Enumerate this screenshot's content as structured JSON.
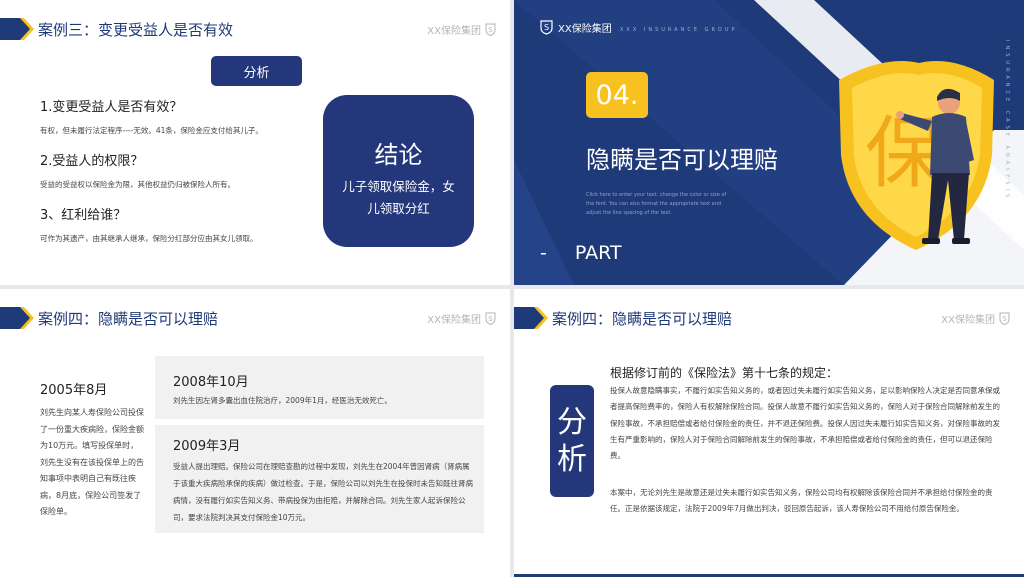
{
  "brand": {
    "name": "XX保险集团",
    "tagline": "XXX INSURANCE GROUP",
    "side_text": "INSURANCE CASE ANALYSIS",
    "navy": "#1f3a78",
    "yellow": "#f7c21f"
  },
  "slide1": {
    "title": "案例三：变更受益人是否有效",
    "analysis_button": "分析",
    "items": [
      {
        "question": "1.变更受益人是否有效？",
        "answer": "有权，但未履行法定程序----无效。41条，保险金应支付给其儿子。"
      },
      {
        "question": "2.受益人的权限？",
        "answer": "受益的受益权以保险金为限，其他权益仍归被保险人所有。"
      },
      {
        "question": "3、红利给谁？",
        "answer": "可作为其遗产，由其继承人继承，保险分红部分应由其女儿领取。"
      }
    ],
    "conclusion": {
      "title": "结论",
      "body": "儿子领取保险金，女儿领取分红"
    }
  },
  "slide2": {
    "number": "04.",
    "title": "隐瞒是否可以理赔",
    "placeholder_text": "Click here to enter your text. change the color or size of the font. You can also format the appropriate text and adjust the line spacing of the text.",
    "part_label": "PART",
    "dash": "-",
    "shield_char": "保"
  },
  "slide3": {
    "title": "案例四：隐瞒是否可以理赔",
    "year_2005": "2005年8月",
    "text_2005": "刘先生向某人寿保险公司投保了一份重大疾病险，保险金额为10万元。填写投保单时，刘先生没有在该投保单上的告知事项中表明自己有既往疾病，8月底，保险公司签发了保险单。",
    "events": [
      {
        "date": "2008年10月",
        "text": "刘先生因左肾多囊出血住院治疗，2009年1月，经医治无效死亡。"
      },
      {
        "date": "2009年3月",
        "text": "受益人提出理赔。保险公司在理赔查勘的过程中发现，刘先生在2004年曾因肾病（肾病属于该重大疾病险承保的疾病）做过检查。于是，保险公司以刘先生在投保时未告知既往肾病病情，没有履行如实告知义务、带病投保为由拒赔，并解除合同。刘先生家人起诉保险公司，要求法院判决其支付保险金10万元。"
      }
    ]
  },
  "slide4": {
    "title": "案例四：隐瞒是否可以理赔",
    "box_char1": "分",
    "box_char2": "析",
    "heading": "根据修订前的《保险法》第十七条的规定：",
    "para1": "投保人故意隐瞒事实，不履行如实告知义务的，或者因过失未履行如实告知义务，足以影响保险人决定是否同意承保或者提高保险费率的，保险人有权解除保险合同。投保人故意不履行如实告知义务的，保险人对于保险合同解除前发生的保险事故，不承担赔偿或者给付保险金的责任，并不退还保险费。投保人因过失未履行如实告知义务，对保险事故的发生有严重影响的，保险人对于保险合同解除前发生的保险事故，不承担赔偿或者给付保险金的责任，但可以退还保险费。",
    "para2": "本案中，无论刘先生是故意还是过失未履行如实告知义务，保险公司均有权解除该保险合同并不承担给付保险金的责任。正是依据该规定，法院于2009年7月做出判决，驳回原告起诉，该人寿保险公司不用给付原告保险金。"
  }
}
